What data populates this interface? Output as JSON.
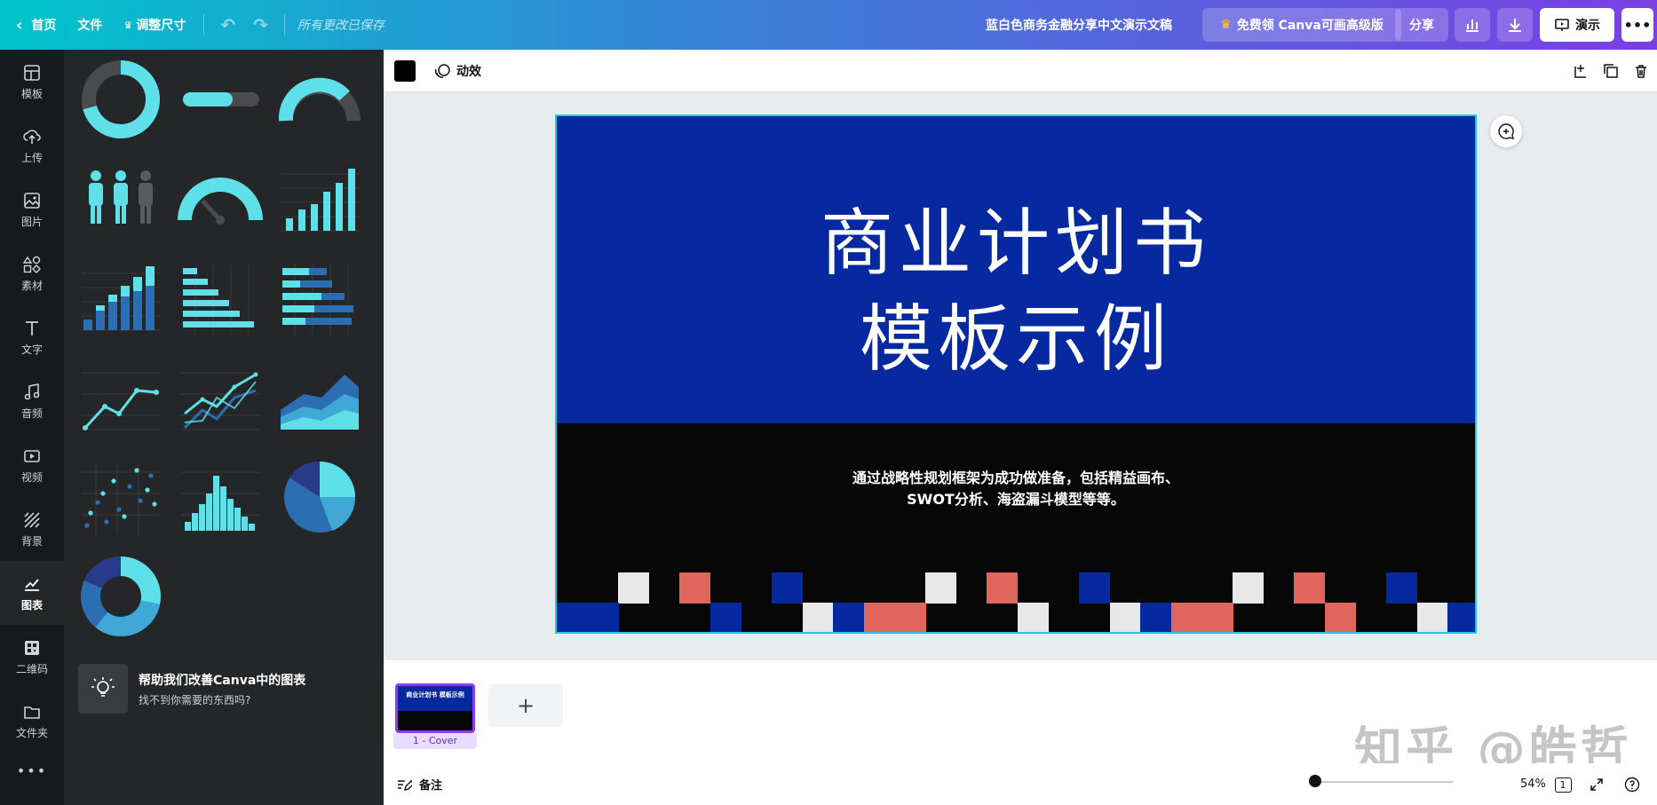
{
  "topbar": {
    "home": "首页",
    "file": "文件",
    "resize": "调整尺寸",
    "saved": "所有更改已保存",
    "doc_title": "蓝白色商务金融分享中文演示文稿",
    "premium": "免费领 Canva可画高级版",
    "share": "分享",
    "present": "演示"
  },
  "sidebar": {
    "items": [
      {
        "label": "模板",
        "icon": "template-icon"
      },
      {
        "label": "上传",
        "icon": "upload-icon"
      },
      {
        "label": "图片",
        "icon": "photo-icon"
      },
      {
        "label": "素材",
        "icon": "elements-icon"
      },
      {
        "label": "文字",
        "icon": "text-icon"
      },
      {
        "label": "音频",
        "icon": "audio-icon"
      },
      {
        "label": "视频",
        "icon": "video-icon"
      },
      {
        "label": "背景",
        "icon": "background-icon"
      },
      {
        "label": "图表",
        "icon": "chart-icon",
        "active": true
      },
      {
        "label": "二维码",
        "icon": "qrcode-icon"
      },
      {
        "label": "文件夹",
        "icon": "folder-icon"
      }
    ]
  },
  "panel": {
    "help_title": "帮助我们改善Canva中的图表",
    "help_sub": "找不到你需要的东西吗?"
  },
  "editbar": {
    "animate": "动效"
  },
  "slide": {
    "title_line1": "商业计划书",
    "title_line2": "模板示例",
    "subtitle_line1": "通过战略性规划框架为成功做准备，包括精益画布、",
    "subtitle_line2": "SWOT分析、海盗漏斗模型等等。",
    "colors": {
      "top": "#0629a0",
      "bottom": "#070707",
      "red": "#e0655c",
      "white": "#e8e8e8",
      "blue": "#0629a0"
    }
  },
  "pages": {
    "thumb_label": "1 - Cover",
    "thumb_title": "商业计划书 模板示例"
  },
  "footer": {
    "notes": "备注",
    "zoom": "54%",
    "page_count": "1"
  },
  "watermark": "知乎 @皓哲",
  "accent": "#5fe0e8"
}
